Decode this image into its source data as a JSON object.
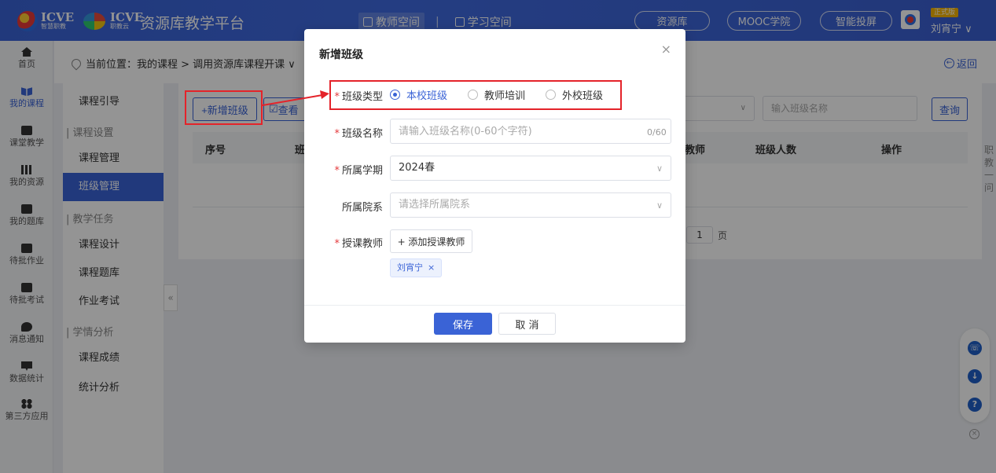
{
  "header": {
    "brand_1": "ICVE",
    "brand_1_sub": "智慧职教",
    "brand_2": "ICVE",
    "brand_2_sub": "职教云",
    "platform_title": "资源库教学平台",
    "space_tabs": [
      {
        "label": "教师空间",
        "active": true
      },
      {
        "label": "学习空间",
        "active": false
      }
    ],
    "space_separator": "|",
    "links": [
      "资源库",
      "MOOC学院",
      "智能投屏"
    ],
    "version_badge": "正式版",
    "user_name": "刘宵宁 ∨"
  },
  "rail": [
    {
      "label": "首页",
      "icon": "home-icon"
    },
    {
      "label": "我的课程",
      "icon": "book-icon",
      "active": true
    },
    {
      "label": "课堂教学",
      "icon": "classroom-icon"
    },
    {
      "label": "我的资源",
      "icon": "resource-icon"
    },
    {
      "label": "我的题库",
      "icon": "question-bank-icon"
    },
    {
      "label": "待批作业",
      "icon": "homework-icon"
    },
    {
      "label": "待批考试",
      "icon": "exam-icon"
    },
    {
      "label": "消息通知",
      "icon": "message-icon"
    },
    {
      "label": "数据统计",
      "icon": "stats-icon"
    },
    {
      "label": "第三方应用",
      "icon": "apps-icon"
    }
  ],
  "breadcrumb": {
    "text": "当前位置：我的课程 > 调用资源库课程开课 ∨",
    "back_label": "返回"
  },
  "subnav": {
    "item_guide": "课程引导",
    "group_settings": "课程设置",
    "item_course_manage": "课程管理",
    "item_class_manage": "班级管理",
    "group_tasks": "教学任务",
    "item_design": "课程设计",
    "item_bank": "课程题库",
    "item_homework": "作业考试",
    "group_analysis": "学情分析",
    "item_scores": "课程成绩",
    "item_stats": "统计分析",
    "collapse": "«"
  },
  "main": {
    "add_class_btn": "+新增班级",
    "view_btn": "查看",
    "search_placeholder": "输入班级名称",
    "query_btn": "查询",
    "columns": {
      "index": "序号",
      "class": "班",
      "teacher": "教师",
      "count": "班级人数",
      "ops": "操作"
    },
    "page_number": "1",
    "page_unit": "页",
    "side_chars": "职教一问"
  },
  "modal": {
    "title": "新增班级",
    "close": "×",
    "required_mark": "*",
    "class_type_label": "班级类型",
    "class_types": [
      {
        "label": "本校班级",
        "checked": true
      },
      {
        "label": "教师培训",
        "checked": false
      },
      {
        "label": "外校班级",
        "checked": false
      }
    ],
    "class_name_label": "班级名称",
    "class_name_placeholder": "请输入班级名称(0-60个字符)",
    "class_name_counter": "0/60",
    "term_label": "所属学期",
    "term_value": "2024春",
    "dept_label": "所属院系",
    "dept_placeholder": "请选择所属院系",
    "teacher_label": "授课教师",
    "add_teacher_btn": "+ 添加授课教师",
    "teacher_tag": "刘宵宁",
    "tag_close": "×",
    "save_btn": "保存",
    "cancel_btn": "取 消"
  },
  "colors": {
    "primary": "#3a63d6",
    "annotation": "#e4232a",
    "required": "#e4393c"
  }
}
